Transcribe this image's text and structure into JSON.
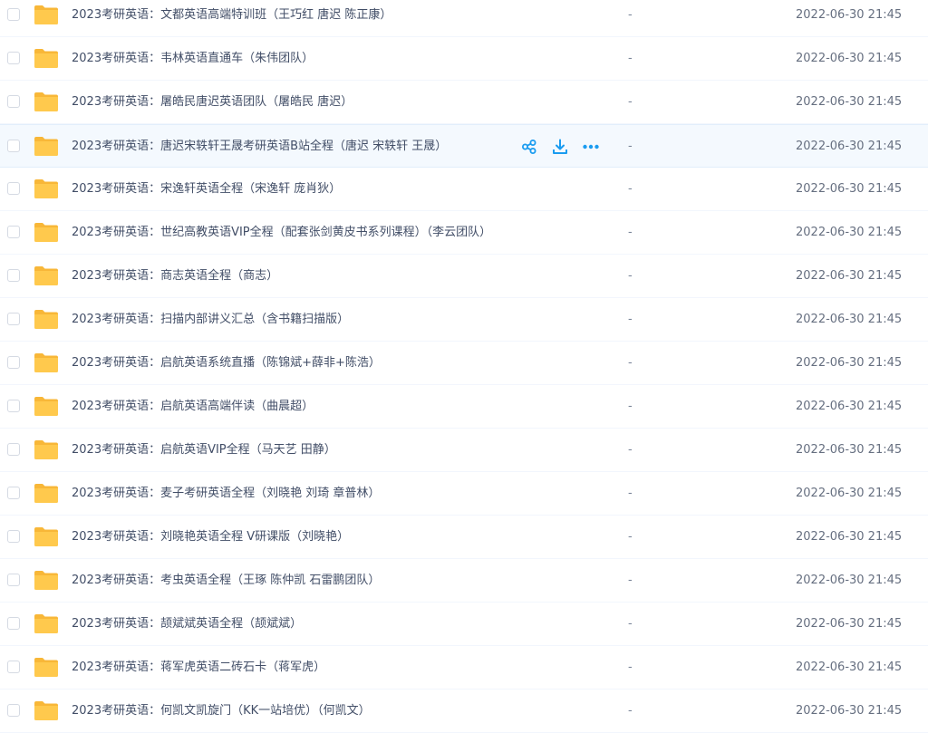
{
  "colors": {
    "folder": "#ffc94d",
    "folder_tab": "#f8b738",
    "accent": "#1a9cf0",
    "hover_bg": "#f4f9fe"
  },
  "rows": [
    {
      "name": "2023考研英语：文都英语高端特训班（王巧红 唐迟 陈正康）",
      "size": "-",
      "time": "2022-06-30 21:45"
    },
    {
      "name": "2023考研英语：韦林英语直通车（朱伟团队）",
      "size": "-",
      "time": "2022-06-30 21:45"
    },
    {
      "name": "2023考研英语：屠皓民唐迟英语团队（屠皓民 唐迟）",
      "size": "-",
      "time": "2022-06-30 21:45"
    },
    {
      "name": "2023考研英语：唐迟宋轶轩王晟考研英语B站全程（唐迟 宋轶轩 王晟）",
      "size": "-",
      "time": "2022-06-30 21:45",
      "hovered": true
    },
    {
      "name": "2023考研英语：宋逸轩英语全程（宋逸轩 庞肖狄）",
      "size": "-",
      "time": "2022-06-30 21:45"
    },
    {
      "name": "2023考研英语：世纪高教英语VIP全程（配套张剑黄皮书系列课程）（李云团队）",
      "size": "-",
      "time": "2022-06-30 21:45"
    },
    {
      "name": "2023考研英语：商志英语全程（商志）",
      "size": "-",
      "time": "2022-06-30 21:45"
    },
    {
      "name": "2023考研英语：扫描内部讲义汇总（含书籍扫描版）",
      "size": "-",
      "time": "2022-06-30 21:45"
    },
    {
      "name": "2023考研英语：启航英语系统直播（陈锦斌+薛非+陈浩）",
      "size": "-",
      "time": "2022-06-30 21:45"
    },
    {
      "name": "2023考研英语：启航英语高端伴读（曲晨超）",
      "size": "-",
      "time": "2022-06-30 21:45"
    },
    {
      "name": "2023考研英语：启航英语VIP全程（马天艺 田静）",
      "size": "-",
      "time": "2022-06-30 21:45"
    },
    {
      "name": "2023考研英语：麦子考研英语全程（刘晓艳 刘琦 章普林）",
      "size": "-",
      "time": "2022-06-30 21:45"
    },
    {
      "name": "2023考研英语：刘晓艳英语全程 V研课版（刘晓艳）",
      "size": "-",
      "time": "2022-06-30 21:45"
    },
    {
      "name": "2023考研英语：考虫英语全程（王琢 陈仲凯 石雷鹏团队）",
      "size": "-",
      "time": "2022-06-30 21:45"
    },
    {
      "name": "2023考研英语：颉斌斌英语全程（颉斌斌）",
      "size": "-",
      "time": "2022-06-30 21:45"
    },
    {
      "name": "2023考研英语：蒋军虎英语二砖石卡（蒋军虎）",
      "size": "-",
      "time": "2022-06-30 21:45"
    },
    {
      "name": "2023考研英语：何凯文凯旋门（KK一站培优）（何凯文）",
      "size": "-",
      "time": "2022-06-30 21:45"
    }
  ],
  "hover_actions": [
    {
      "name": "share-icon",
      "label": "share"
    },
    {
      "name": "download-icon",
      "label": "download"
    },
    {
      "name": "more-icon",
      "label": "more"
    }
  ]
}
